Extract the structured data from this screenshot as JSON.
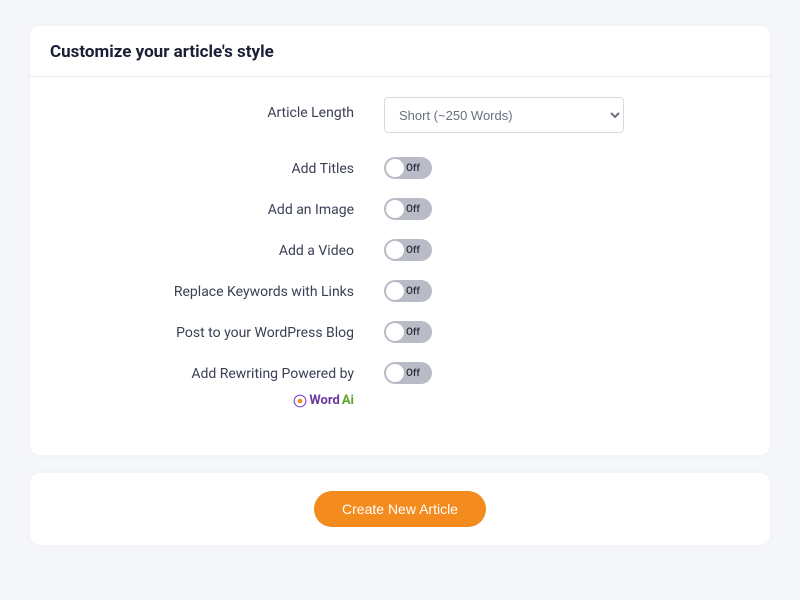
{
  "header": {
    "title": "Customize your article's style"
  },
  "fields": {
    "article_length": {
      "label": "Article Length",
      "selected": "Short (~250 Words)"
    },
    "add_titles": {
      "label": "Add Titles",
      "state": "Off"
    },
    "add_image": {
      "label": "Add an Image",
      "state": "Off"
    },
    "add_video": {
      "label": "Add a Video",
      "state": "Off"
    },
    "replace_keywords": {
      "label": "Replace Keywords with Links",
      "state": "Off"
    },
    "post_wordpress": {
      "label": "Post to your WordPress Blog",
      "state": "Off"
    },
    "rewriting": {
      "label": "Add Rewriting Powered by",
      "state": "Off",
      "brand_word": "Word",
      "brand_ai": "Ai"
    }
  },
  "actions": {
    "create_label": "Create New Article"
  }
}
